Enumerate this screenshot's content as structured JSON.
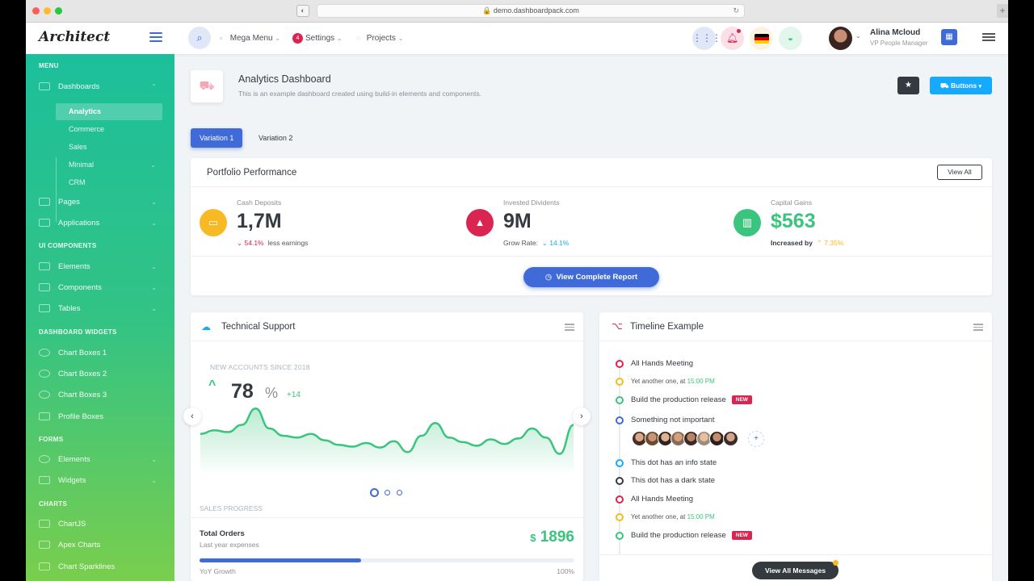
{
  "browser": {
    "url": "demo.dashboardpack.com"
  },
  "header": {
    "logo": "Architect",
    "nav": [
      {
        "label": "Mega Menu"
      },
      {
        "label": "Settings",
        "badge": "4"
      },
      {
        "label": "Projects"
      }
    ],
    "user": {
      "name": "Alina Mcloud",
      "role": "VP People Manager"
    }
  },
  "sidebar": {
    "heading_menu": "MENU",
    "dashboards": "Dashboards",
    "sub": [
      "Analytics",
      "Commerce",
      "Sales",
      "Minimal",
      "CRM"
    ],
    "pages": "Pages",
    "applications": "Applications",
    "heading_ui": "UI COMPONENTS",
    "elements": "Elements",
    "components": "Components",
    "tables": "Tables",
    "heading_widgets": "DASHBOARD WIDGETS",
    "chart_boxes_1": "Chart Boxes 1",
    "chart_boxes_2": "Chart Boxes 2",
    "chart_boxes_3": "Chart Boxes 3",
    "profile_boxes": "Profile Boxes",
    "heading_forms": "FORMS",
    "forms_elements": "Elements",
    "widgets": "Widgets",
    "heading_charts": "CHARTS",
    "chartjs": "ChartJS",
    "apex": "Apex Charts",
    "sparklines": "Chart Sparklines"
  },
  "page": {
    "title": "Analytics Dashboard",
    "subtitle": "This is an example dashboard created using build-in elements and components.",
    "buttons_label": "Buttons"
  },
  "tabs": [
    "Variation 1",
    "Variation 2"
  ],
  "portfolio": {
    "title": "Portfolio Performance",
    "view_all": "View All",
    "metrics": [
      {
        "label": "Cash Deposits",
        "value": "1,7M",
        "pct": "54.1%",
        "note": "less earnings",
        "color": "#f7b924"
      },
      {
        "label": "Invested Dividents",
        "value": "9M",
        "pct": "14.1%",
        "note": "Grow Rate:",
        "color": "#d92550"
      },
      {
        "label": "Capital Gains",
        "value": "$563",
        "pct": "7.35%",
        "note": "Increased by",
        "color": "#3ac47d"
      }
    ],
    "report_button": "View Complete Report"
  },
  "support": {
    "title": "Technical Support",
    "caption": "NEW ACCOUNTS SINCE 2018",
    "big_value": "78",
    "unit": "%",
    "delta": "+14",
    "sales_progress": "SALES PROGRESS",
    "total_orders": "Total Orders",
    "last_year": "Last year expenses",
    "orders_value": "1896",
    "currency": "$",
    "yoy": "YoY Growth",
    "yoy_pct": "100%",
    "progress": 0.43
  },
  "timeline": {
    "title": "Timeline Example",
    "items": [
      {
        "text": "All Hands Meeting",
        "color": "#d92550"
      },
      {
        "prefix": "Yet another one, at",
        "time": "15:00 PM",
        "color": "#f7b924"
      },
      {
        "text": "Build the production release",
        "badge": "NEW",
        "color": "#3ac47d"
      },
      {
        "text": "Something not important",
        "color": "#3f6ad8"
      },
      {
        "text": "This dot has an info state",
        "color": "#16aaff"
      },
      {
        "text": "This dot has a dark state",
        "color": "#343a40"
      },
      {
        "text": "All Hands Meeting",
        "color": "#d92550"
      },
      {
        "prefix": "Yet another one, at",
        "time": "15:00 PM",
        "color": "#f7b924"
      },
      {
        "text": "Build the production release",
        "badge": "NEW",
        "color": "#3ac47d"
      }
    ],
    "messages_button": "View All Messages"
  },
  "chart_data": {
    "type": "area",
    "title": "",
    "xlabel": "",
    "ylabel": "",
    "values": [
      42,
      46,
      44,
      52,
      70,
      48,
      40,
      38,
      42,
      35,
      30,
      28,
      32,
      27,
      34,
      22,
      40,
      54,
      38,
      33,
      29,
      36,
      31,
      37,
      48,
      38,
      20,
      52
    ],
    "color": "#3ac47d"
  }
}
